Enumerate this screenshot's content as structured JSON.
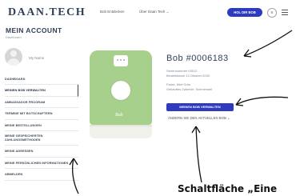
{
  "header": {
    "logo": "DAAN.TECH",
    "nav": [
      "Bob Entdecken",
      "Über Daan Tech ⌄"
    ],
    "cta": "HOL DIR BOB",
    "cart_icon": "cart-icon",
    "menu_icon": "hamburger-icon"
  },
  "page": {
    "title": "MEIN ACCOUNT",
    "breadcrumb": "Dashboard"
  },
  "sidebar": {
    "username": "My Name",
    "items": [
      "DASHBOARD",
      "MEINEN BOB VERWALTEN",
      "AMBASSADOR PROGRAM",
      "TERMINE MIT BOTSCHAFTERN",
      "MEINE BESTELLUNGEN",
      "MEINE GESPEICHERTEN ZAHLUNGSMETHODEN",
      "MEINE ADRESSEN",
      "MEINE PERSÖNLICHEN INFORMATIONEN",
      "ABMELDEN"
    ]
  },
  "device": {
    "brand_label": "Bob",
    "name": "Bob #0006183",
    "serial": "Seriennummer 00012",
    "purchase_date": "Bestelldatum 13 Oktober 2020",
    "color": "Farbe: Mint Grün",
    "accessories": "Gekauftes Zubehör: Schmerwell",
    "manage_button": "MEINEN BOB VERWALTEN",
    "change_button": "ÄNDERN SIE DEN AKTUELLEN BOB ⌄"
  },
  "annotation": {
    "callout": "Schaltfläche „Eine"
  },
  "colors": {
    "accent": "#2e3bbf",
    "device_green": "#a8d08d",
    "heading": "#2e3f57"
  }
}
